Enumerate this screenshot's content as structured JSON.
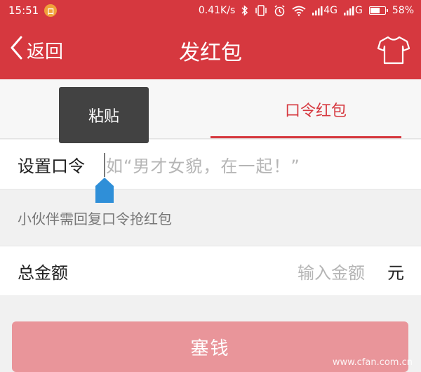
{
  "status_bar": {
    "time": "15:51",
    "app_badge": "口",
    "network_speed": "0.41K/s",
    "signal_4g": "4G",
    "signal_g": "G",
    "battery_percent": "58%",
    "battery_level": 0.58
  },
  "nav": {
    "back_label": "返回",
    "title": "发红包"
  },
  "tabs": [
    {
      "label": ""
    },
    {
      "label": "口令红包"
    }
  ],
  "popup": {
    "paste_label": "粘贴"
  },
  "form": {
    "password_label": "设置口令",
    "password_placeholder": "如“男才女貌，在一起！”",
    "hint": "小伙伴需回复口令抢红包",
    "amount_label": "总金额",
    "amount_placeholder": "输入金额",
    "amount_unit": "元"
  },
  "submit": {
    "label": "塞钱"
  },
  "watermark": "www.cfan.com.cn",
  "colors": {
    "brand_red": "#d6383f",
    "button_disabled": "#e9959a"
  }
}
